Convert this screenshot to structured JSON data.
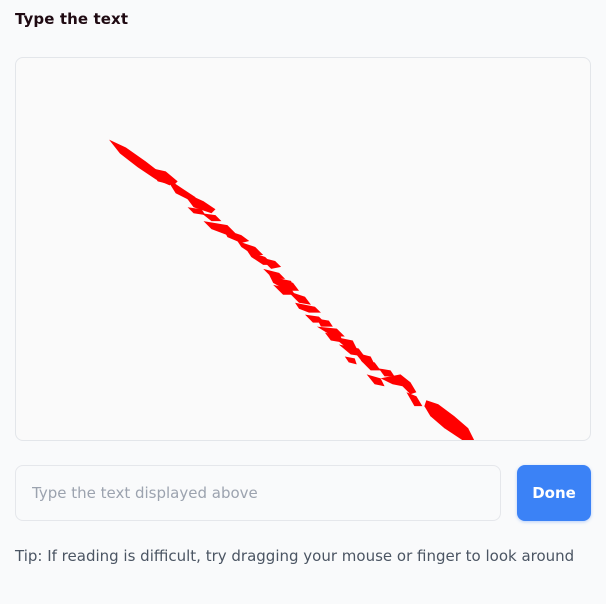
{
  "header": {
    "title": "Type the text"
  },
  "captcha": {
    "stroke_color": "#ff0000",
    "background_color": "#fafafa"
  },
  "answer": {
    "value": "",
    "placeholder": "Type the text displayed above"
  },
  "actions": {
    "done_label": "Done",
    "accent_color": "#3b82f6"
  },
  "footer": {
    "tip": "Tip: If reading is difficult, try dragging your mouse or finger to look around"
  }
}
